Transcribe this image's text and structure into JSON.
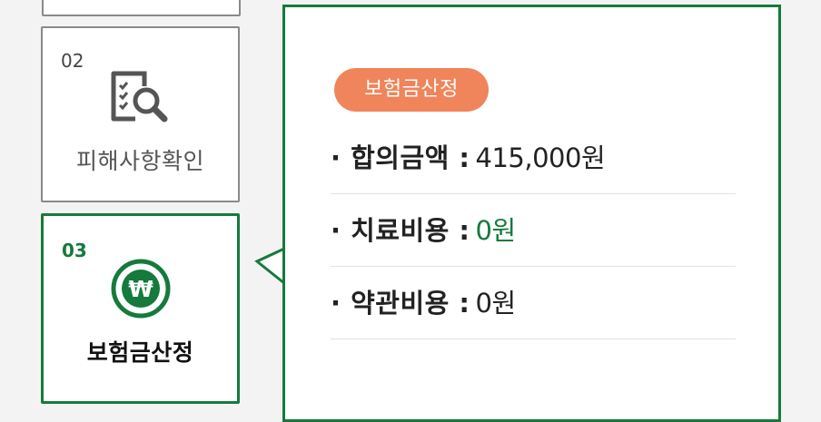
{
  "steps": [
    {
      "number": "02",
      "label": "피해사항확인",
      "icon": "document-search-icon",
      "active": false
    },
    {
      "number": "03",
      "label": "보험금산정",
      "icon": "won-coin-icon",
      "active": true
    }
  ],
  "panel": {
    "badge": "보험금산정",
    "rows": [
      {
        "label": "· 합의금액 :",
        "value": "415,000원"
      },
      {
        "label": "· 치료비용 :",
        "value": "0원"
      },
      {
        "label": "· 약관비용 :",
        "value": "0원"
      }
    ]
  },
  "colors": {
    "accent_green": "#157a3c",
    "badge_orange": "#f0845a",
    "inactive_border": "#8a8a8a",
    "inactive_icon": "#555555"
  }
}
